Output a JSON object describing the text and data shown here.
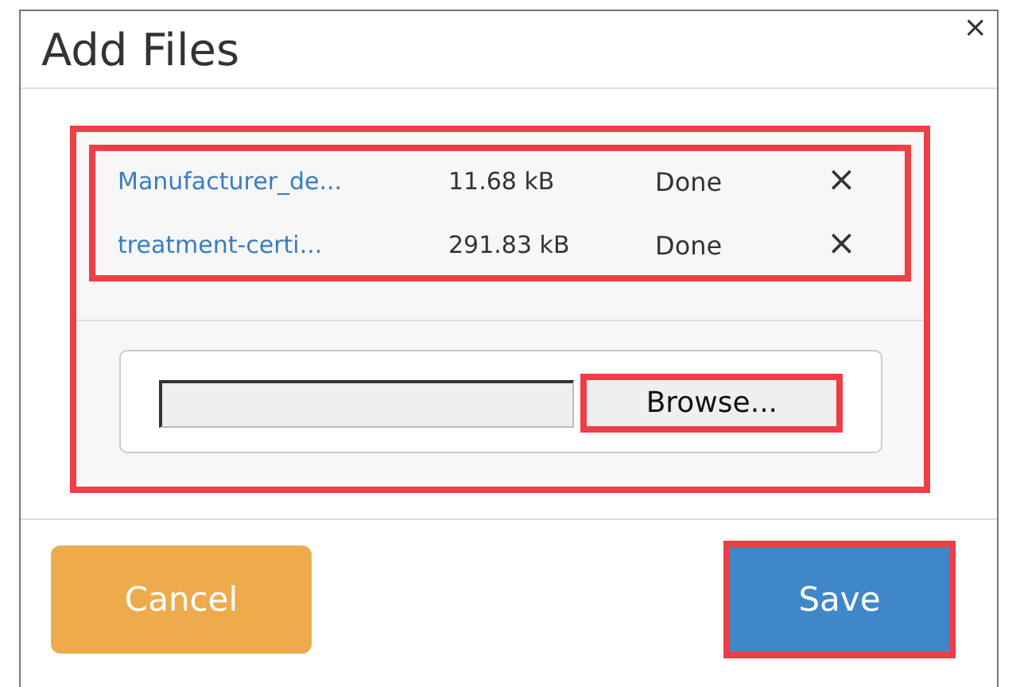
{
  "dialog": {
    "title": "Add Files",
    "close": "×"
  },
  "files": {
    "highlighted": true,
    "items": [
      {
        "name": "Manufacturer_de...",
        "size": "11.68 kB",
        "status": "Done",
        "remove": "×"
      },
      {
        "name": "treatment-certi...",
        "size": "291.83 kB",
        "status": "Done",
        "remove": "×"
      }
    ]
  },
  "upload": {
    "highlighted": true,
    "browse": {
      "label": "Browse...",
      "highlighted": true
    }
  },
  "buttons": [
    {
      "kind": "cancel",
      "label": "Cancel",
      "highlighted": false
    },
    {
      "kind": "save",
      "label": "Save",
      "highlighted": true
    }
  ]
}
